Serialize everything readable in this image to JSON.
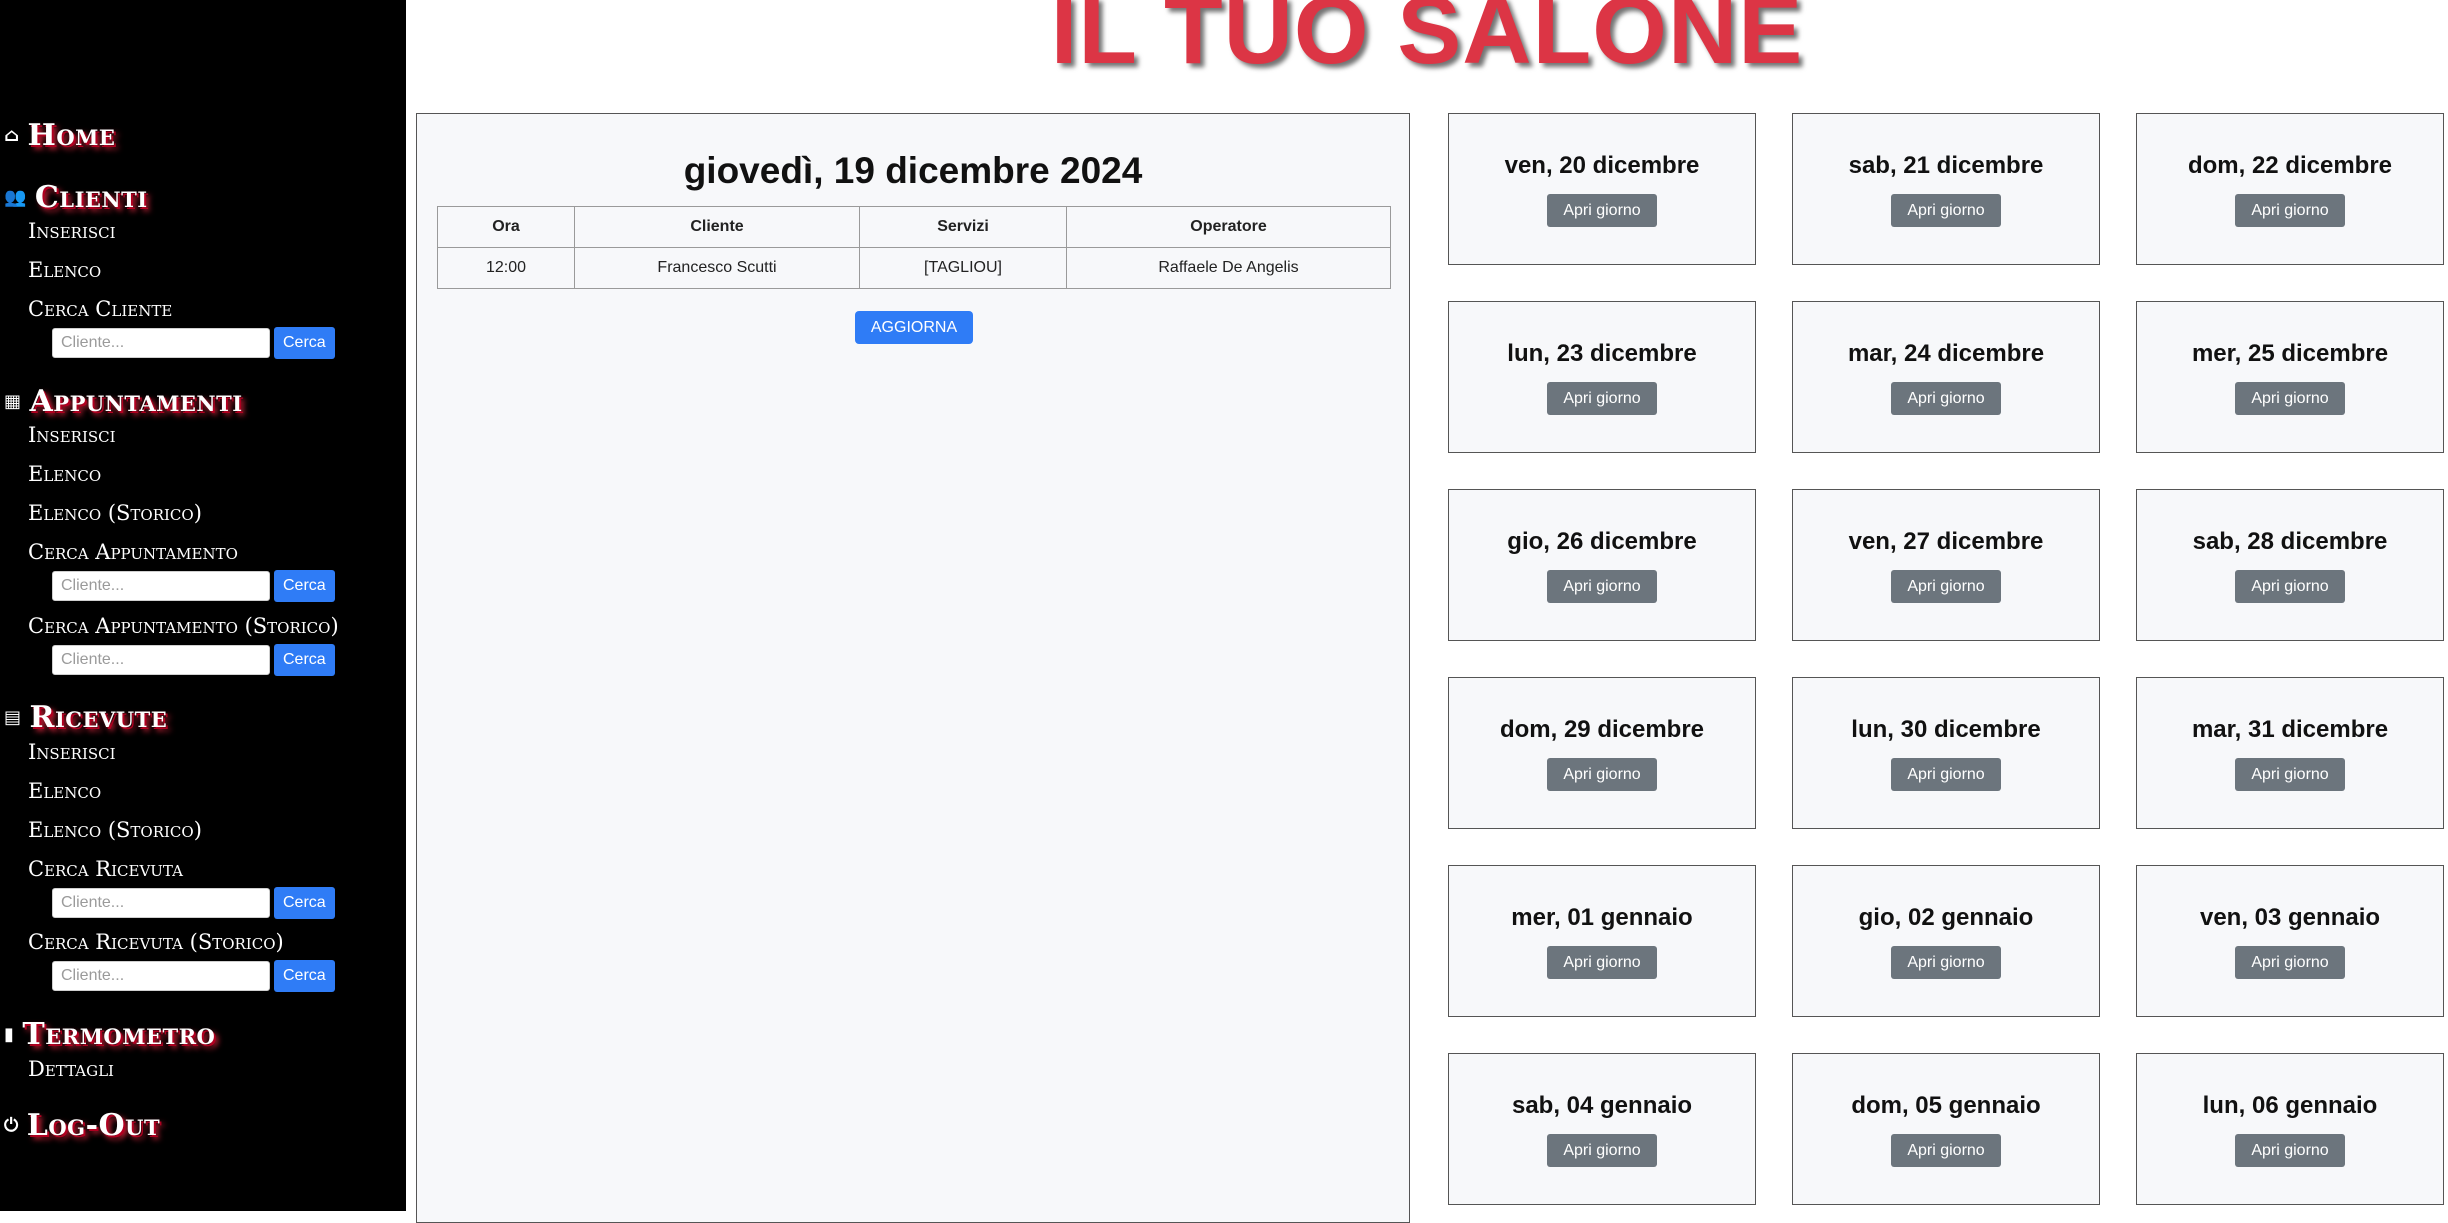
{
  "header": {
    "title": "IL TUO SALONE"
  },
  "sidebar": {
    "home": {
      "icon": "home-icon",
      "label": "Home"
    },
    "clienti": {
      "icon": "users-icon",
      "label": "Clienti",
      "items": [
        "Inserisci",
        "Elenco",
        "Cerca Cliente"
      ],
      "search": {
        "placeholder": "Cliente...",
        "button": "Cerca"
      }
    },
    "appuntamenti": {
      "icon": "calendar-icon",
      "label": "Appuntamenti",
      "items": [
        "Inserisci",
        "Elenco",
        "Elenco (Storico)",
        "Cerca Appuntamento",
        "Cerca Appuntamento (Storico)"
      ],
      "search1": {
        "placeholder": "Cliente...",
        "button": "Cerca"
      },
      "search2": {
        "placeholder": "Cliente...",
        "button": "Cerca"
      }
    },
    "ricevute": {
      "icon": "receipt-icon",
      "label": "Ricevute",
      "items": [
        "Inserisci",
        "Elenco",
        "Elenco (Storico)",
        "Cerca Ricevuta",
        "Cerca Ricevuta (Storico)"
      ],
      "search1": {
        "placeholder": "Cliente...",
        "button": "Cerca"
      },
      "search2": {
        "placeholder": "Cliente...",
        "button": "Cerca"
      }
    },
    "termometro": {
      "icon": "thermometer-icon",
      "label": "Termometro",
      "items": [
        "Dettagli"
      ]
    },
    "logout": {
      "icon": "power-icon",
      "label": "Log-Out"
    }
  },
  "day": {
    "title": "giovedì, 19 dicembre 2024",
    "columns": [
      "Ora",
      "Cliente",
      "Servizi",
      "Operatore"
    ],
    "rows": [
      [
        "12:00",
        "Francesco Scutti",
        "[TAGLIOU]",
        "Raffaele De Angelis"
      ]
    ],
    "refresh_label": "AGGIORNA"
  },
  "days": {
    "button_label": "Apri giorno",
    "list": [
      "ven, 20 dicembre",
      "sab, 21 dicembre",
      "dom, 22 dicembre",
      "lun, 23 dicembre",
      "mar, 24 dicembre",
      "mer, 25 dicembre",
      "gio, 26 dicembre",
      "ven, 27 dicembre",
      "sab, 28 dicembre",
      "dom, 29 dicembre",
      "lun, 30 dicembre",
      "mar, 31 dicembre",
      "mer, 01 gennaio",
      "gio, 02 gennaio",
      "ven, 03 gennaio",
      "sab, 04 gennaio",
      "dom, 05 gennaio",
      "lun, 06 gennaio"
    ]
  },
  "colors": {
    "title_red": "#dc3545",
    "primary_blue": "#2f7cf6",
    "secondary_gray": "#6c757d",
    "sidebar_bg": "#000000"
  }
}
